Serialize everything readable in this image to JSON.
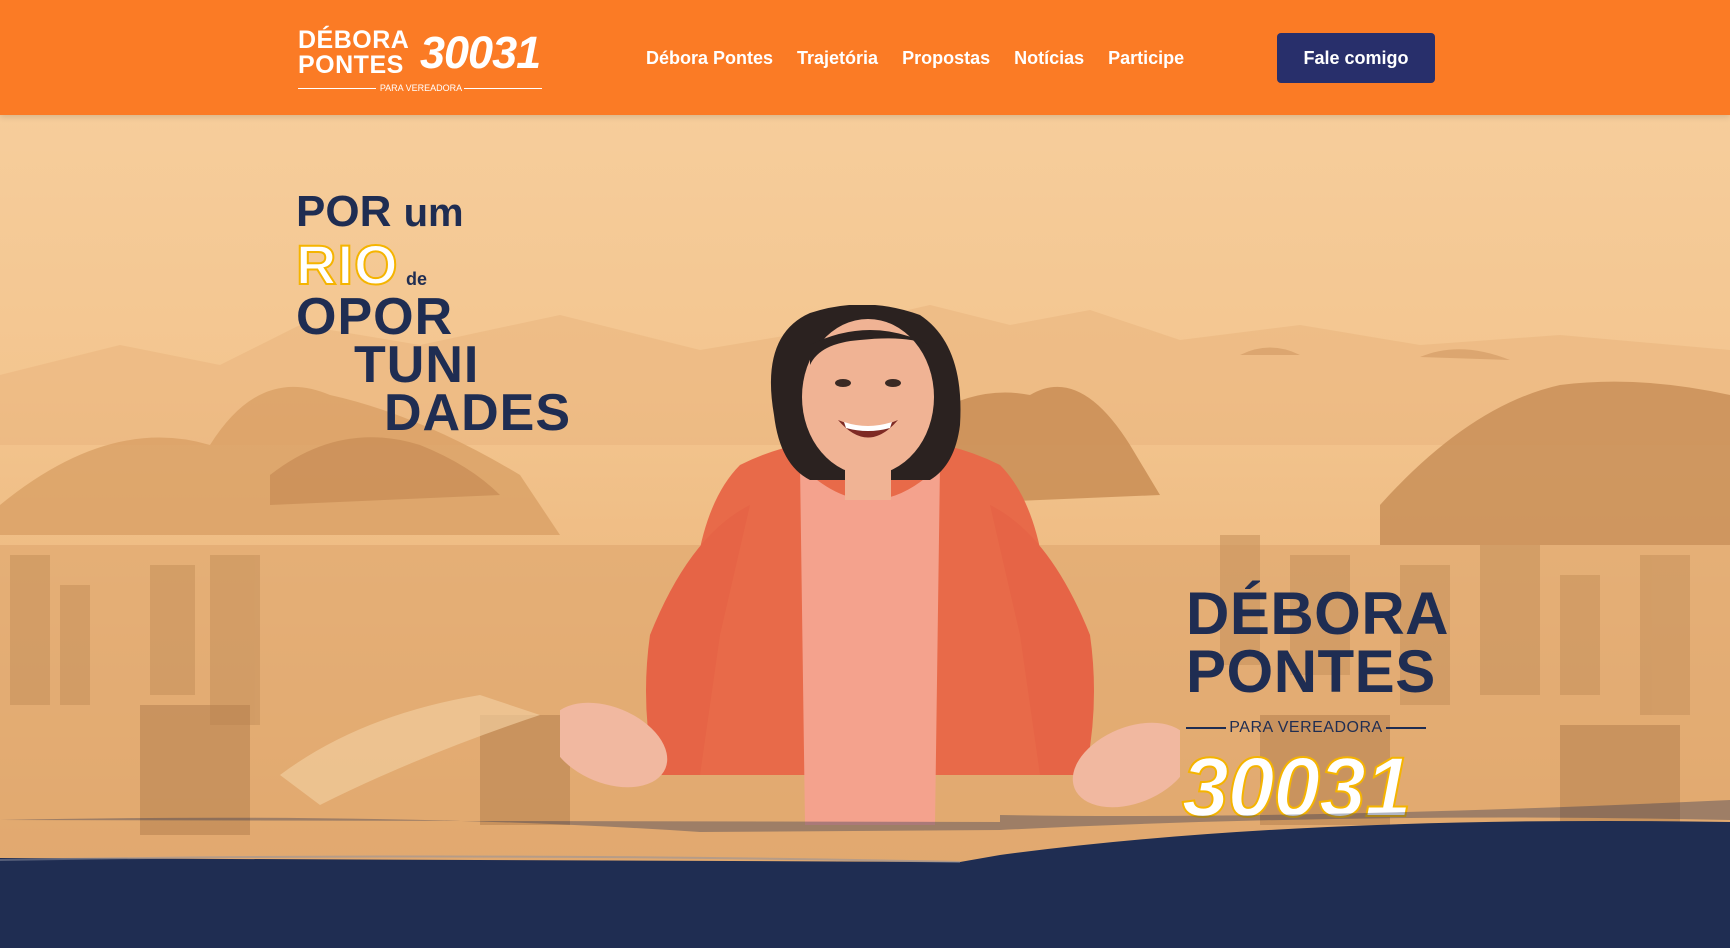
{
  "header": {
    "logo": {
      "name_line1": "DÉBORA",
      "name_line2": "PONTES",
      "number": "30031",
      "subtitle": "PARA VEREADORA"
    },
    "nav": [
      "Débora Pontes",
      "Trajetória",
      "Propostas",
      "Notícias",
      "Participe"
    ],
    "cta_label": "Fale comigo"
  },
  "hero": {
    "slogan": {
      "line1_a": "POR",
      "line1_b": "um",
      "line2_a": "RIO",
      "line2_b": "de",
      "line3": "OPOR",
      "line4": "TUNI",
      "line5": "DADES"
    },
    "badge": {
      "name_line1": "DÉBORA",
      "name_line2": "PONTES",
      "subtitle": "PARA VEREADORA",
      "number": "30031"
    }
  },
  "colors": {
    "header_bg": "#fb7b25",
    "cta_bg": "#282f6b",
    "navy": "#1f2d52",
    "accent_yellow": "#f5b400"
  }
}
